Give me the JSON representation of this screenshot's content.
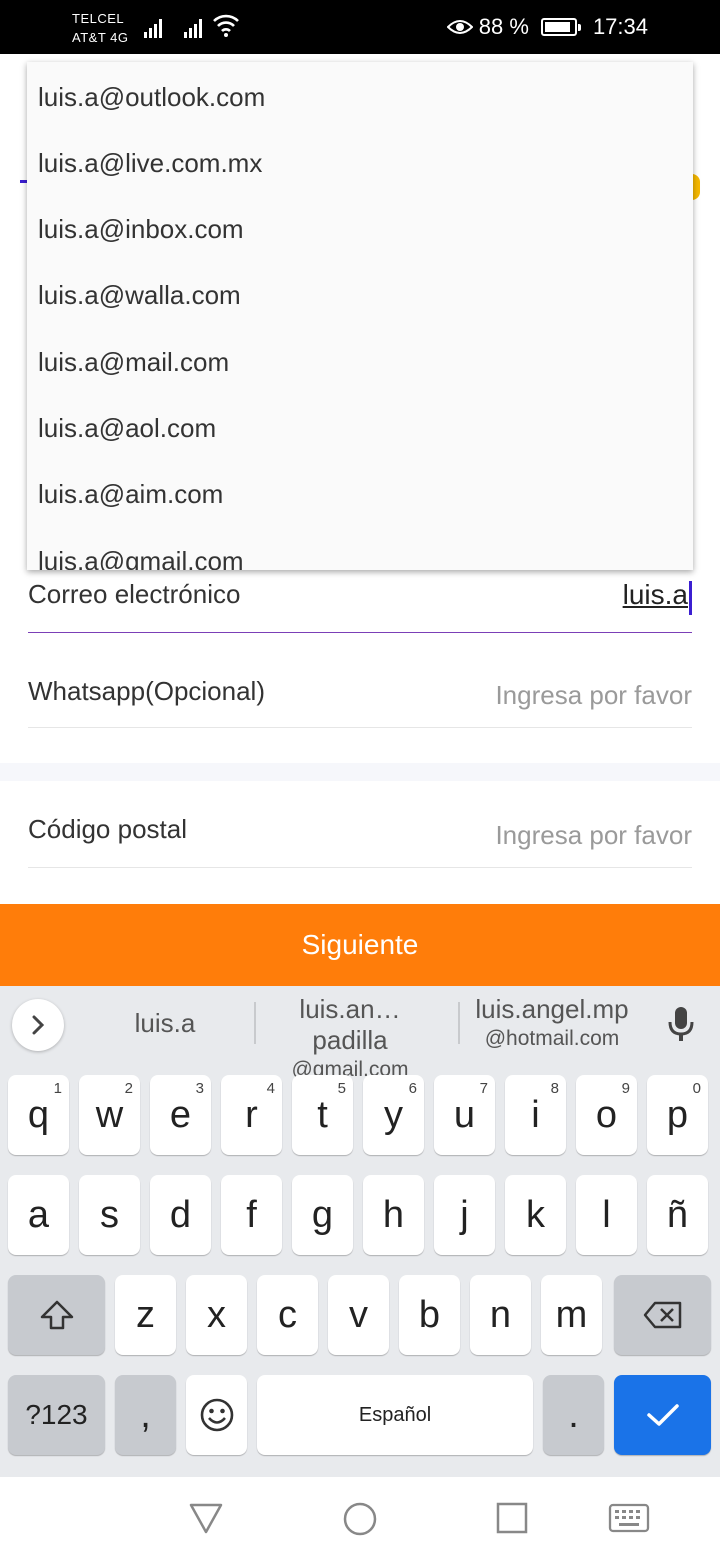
{
  "status_bar": {
    "carrier1": "TELCEL",
    "carrier2": "AT&T 4G",
    "battery_percent": "88 %",
    "battery_level": 0.88,
    "time": "17:34"
  },
  "form": {
    "email_label": "Correo electrónico",
    "email_value": "luis.a",
    "whatsapp_label": "Whatsapp(Opcional)",
    "whatsapp_placeholder": "Ingresa por favor",
    "postal_label": "Código postal",
    "postal_placeholder": "Ingresa por favor",
    "next_button": "Siguiente"
  },
  "autocomplete": {
    "options": [
      "luis.a@outlook.com",
      "luis.a@live.com.mx",
      "luis.a@inbox.com",
      "luis.a@walla.com",
      "luis.a@mail.com",
      "luis.a@aol.com",
      "luis.a@aim.com",
      "luis.a@gmail.com"
    ]
  },
  "keyboard": {
    "suggestions": {
      "s1": "luis.a",
      "s2_main": "luis.an…padilla",
      "s2_sub": "@gmail.com",
      "s3_main": "luis.angel.mp",
      "s3_sub": "@hotmail.com"
    },
    "row1": [
      "q",
      "w",
      "e",
      "r",
      "t",
      "y",
      "u",
      "i",
      "o",
      "p"
    ],
    "row1_hints": [
      "1",
      "2",
      "3",
      "4",
      "5",
      "6",
      "7",
      "8",
      "9",
      "0"
    ],
    "row2": [
      "a",
      "s",
      "d",
      "f",
      "g",
      "h",
      "j",
      "k",
      "l",
      "ñ"
    ],
    "row3": [
      "z",
      "x",
      "c",
      "v",
      "b",
      "n",
      "m"
    ],
    "symbols_key": "?123",
    "comma_key": ",",
    "space_key": "Español",
    "period_key": "."
  },
  "icons": {
    "eye": "eye-icon",
    "wifi": "wifi-icon",
    "mic": "microphone-icon",
    "shift": "shift-icon",
    "backspace": "backspace-icon",
    "emoji": "emoji-icon",
    "enter": "checkmark-icon",
    "nav_back": "back-triangle-icon",
    "nav_home": "home-circle-icon",
    "nav_recents": "recents-square-icon",
    "nav_keyboard": "keyboard-icon"
  },
  "colors": {
    "accent_orange": "#ff7d0a",
    "keyboard_blue": "#1a73e8",
    "cursor_purple": "#3b1fd1"
  }
}
